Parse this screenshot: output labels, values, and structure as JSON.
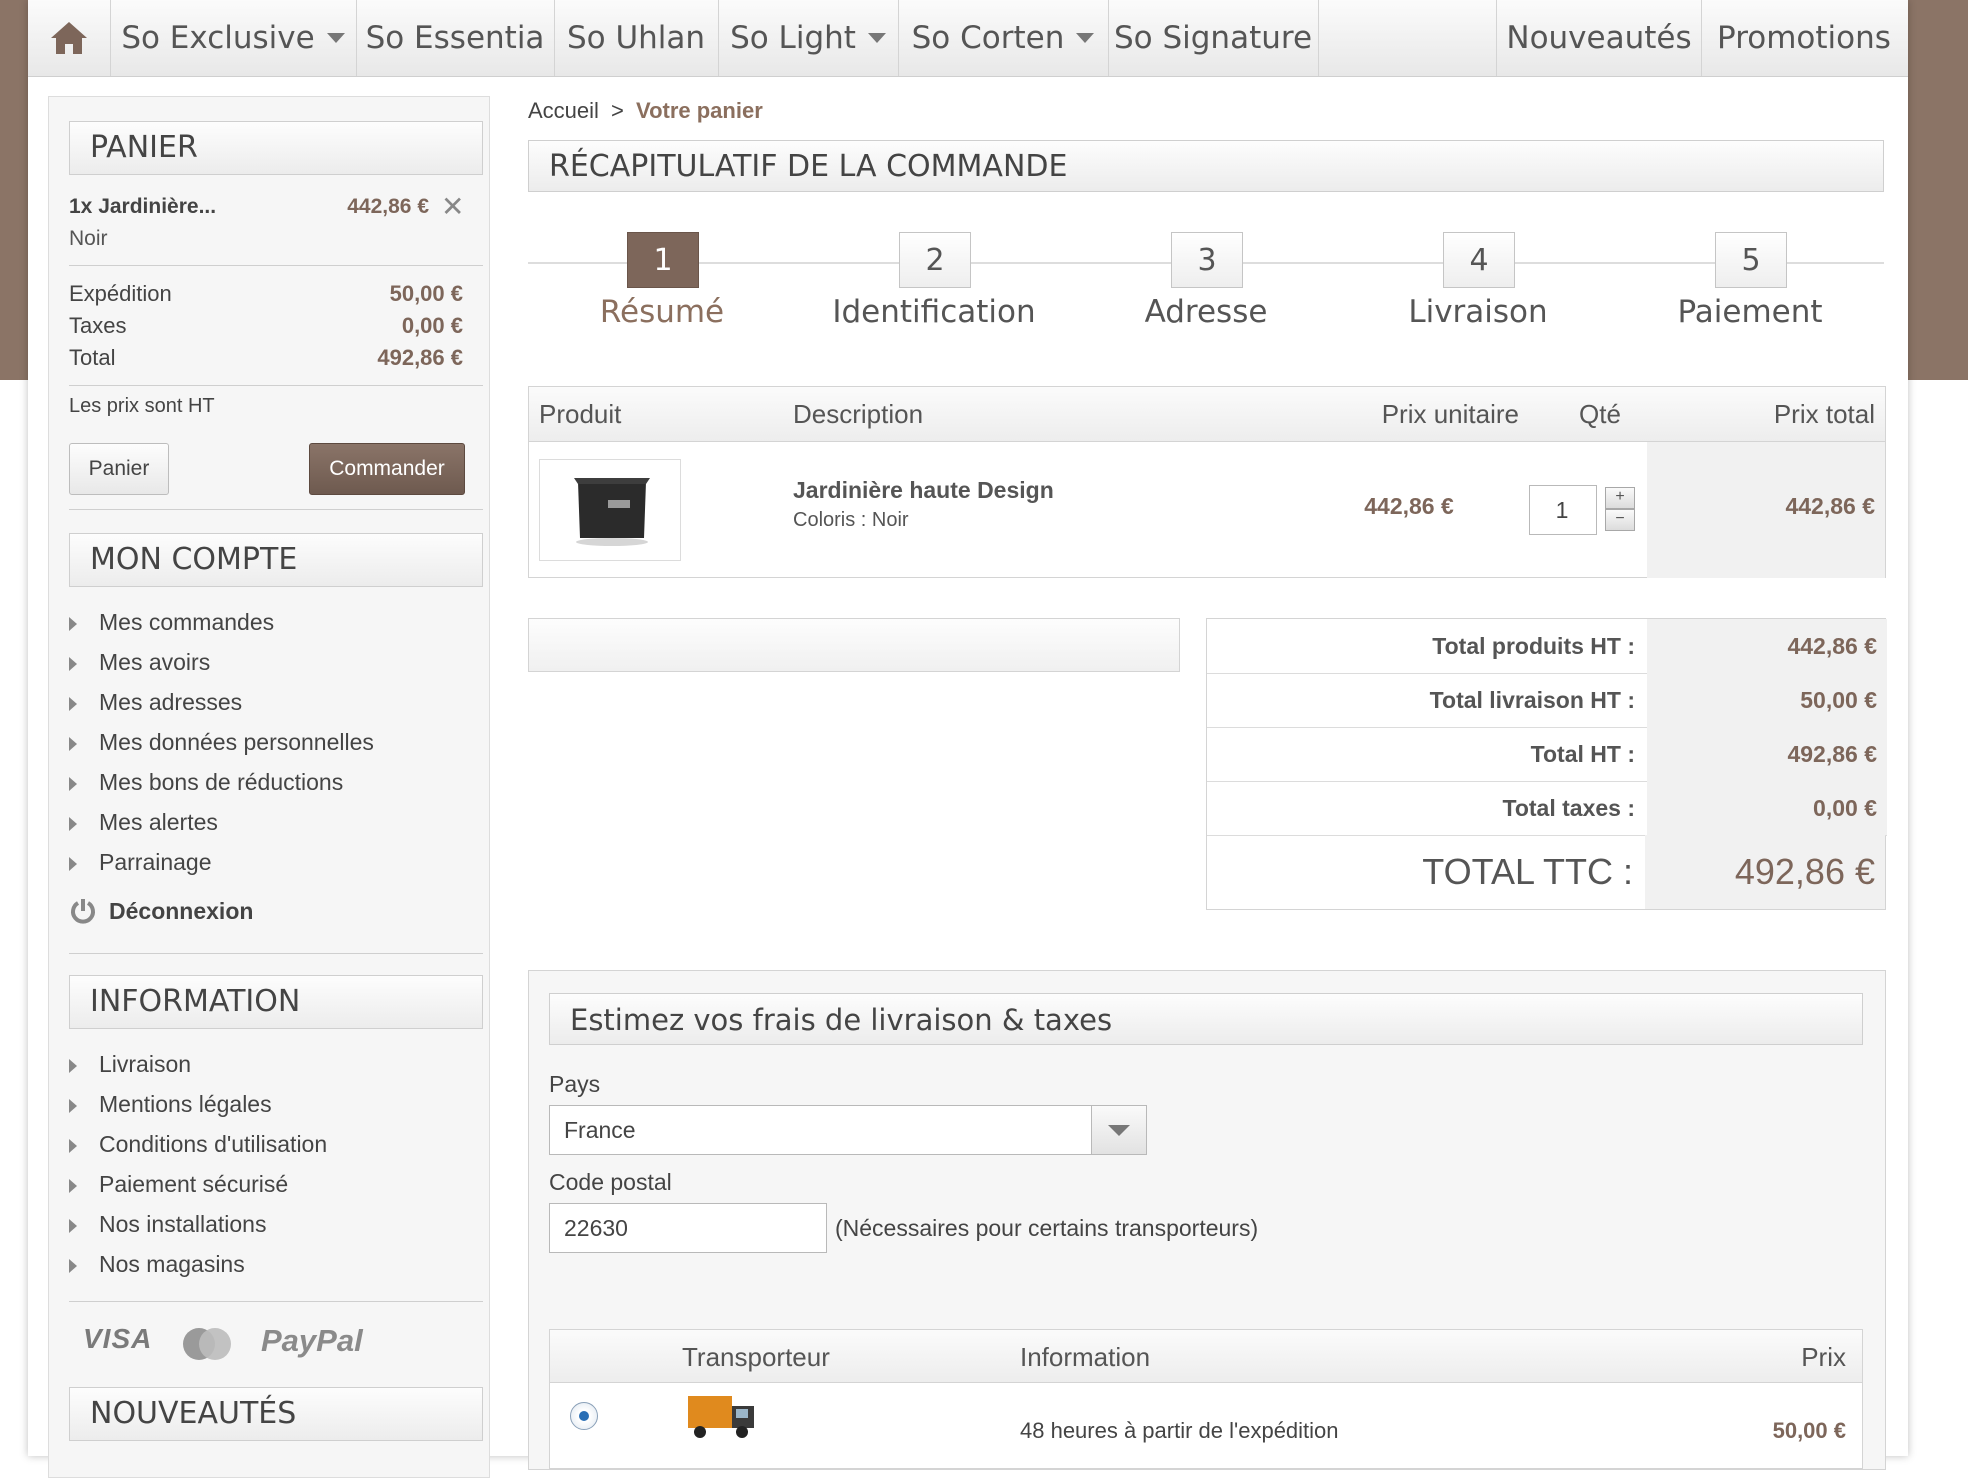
{
  "nav": {
    "items": [
      "So Exclusive",
      "So Essentia",
      "So Uhlan",
      "So Light",
      "So Corten",
      "So Signature"
    ],
    "right_items": [
      "Nouveautés",
      "Promotions"
    ],
    "home_icon": "home-icon"
  },
  "cart": {
    "title": "PANIER",
    "item_name": "1x Jardinière...",
    "item_variant": "Noir",
    "item_price": "442,86 €",
    "shipping_label": "Expédition",
    "shipping_value": "50,00 €",
    "tax_label": "Taxes",
    "tax_value": "0,00 €",
    "total_label": "Total",
    "total_value": "492,86 €",
    "note": "Les prix sont HT",
    "cart_button": "Panier",
    "order_button": "Commander"
  },
  "account": {
    "title": "MON COMPTE",
    "items": [
      "Mes commandes",
      "Mes avoirs",
      "Mes adresses",
      "Mes données personnelles",
      "Mes bons de réductions",
      "Mes alertes",
      "Parrainage"
    ],
    "logout": "Déconnexion"
  },
  "information": {
    "title": "INFORMATION",
    "items": [
      "Livraison",
      "Mentions légales",
      "Conditions d'utilisation",
      "Paiement sécurisé",
      "Nos installations",
      "Nos magasins"
    ]
  },
  "payment_logos": [
    "VISA",
    "MasterCard",
    "PayPal"
  ],
  "new_products": {
    "title": "NOUVEAUTÉS"
  },
  "breadcrumb": {
    "home": "Accueil",
    "separator": ">",
    "current": "Votre panier"
  },
  "page_title": "RÉCAPITULATIF DE LA COMMANDE",
  "steps": [
    {
      "number": "1",
      "label": "Résumé"
    },
    {
      "number": "2",
      "label": "Identification"
    },
    {
      "number": "3",
      "label": "Adresse"
    },
    {
      "number": "4",
      "label": "Livraison"
    },
    {
      "number": "5",
      "label": "Paiement"
    }
  ],
  "cart_table": {
    "headers": [
      "Produit",
      "Description",
      "Prix unitaire",
      "Qté",
      "Prix total"
    ],
    "row": {
      "name": "Jardinière haute Design",
      "variant": "Coloris : Noir",
      "unit_price": "442,86 €",
      "quantity": "1",
      "total": "442,86 €"
    }
  },
  "totals": [
    {
      "label": "Total produits HT :",
      "value": "442,86 €"
    },
    {
      "label": "Total livraison HT :",
      "value": "50,00 €"
    },
    {
      "label": "Total HT :",
      "value": "492,86 €"
    },
    {
      "label": "Total taxes :",
      "value": "0,00 €"
    }
  ],
  "total_ttc": {
    "label": "TOTAL TTC :",
    "value": "492,86 €"
  },
  "estimate": {
    "title": "Estimez vos frais de livraison & taxes",
    "country_label": "Pays",
    "country_value": "France",
    "postal_label": "Code postal",
    "postal_value": "22630",
    "postal_note": "(Nécessaires pour certains transporteurs)",
    "carrier_headers": [
      "Transporteur",
      "Information",
      "Prix"
    ],
    "carrier": {
      "info": "48 heures à partir de l'expédition",
      "price": "50,00 €"
    }
  },
  "colors": {
    "accent": "#7d665a",
    "band": "#8b7466"
  }
}
